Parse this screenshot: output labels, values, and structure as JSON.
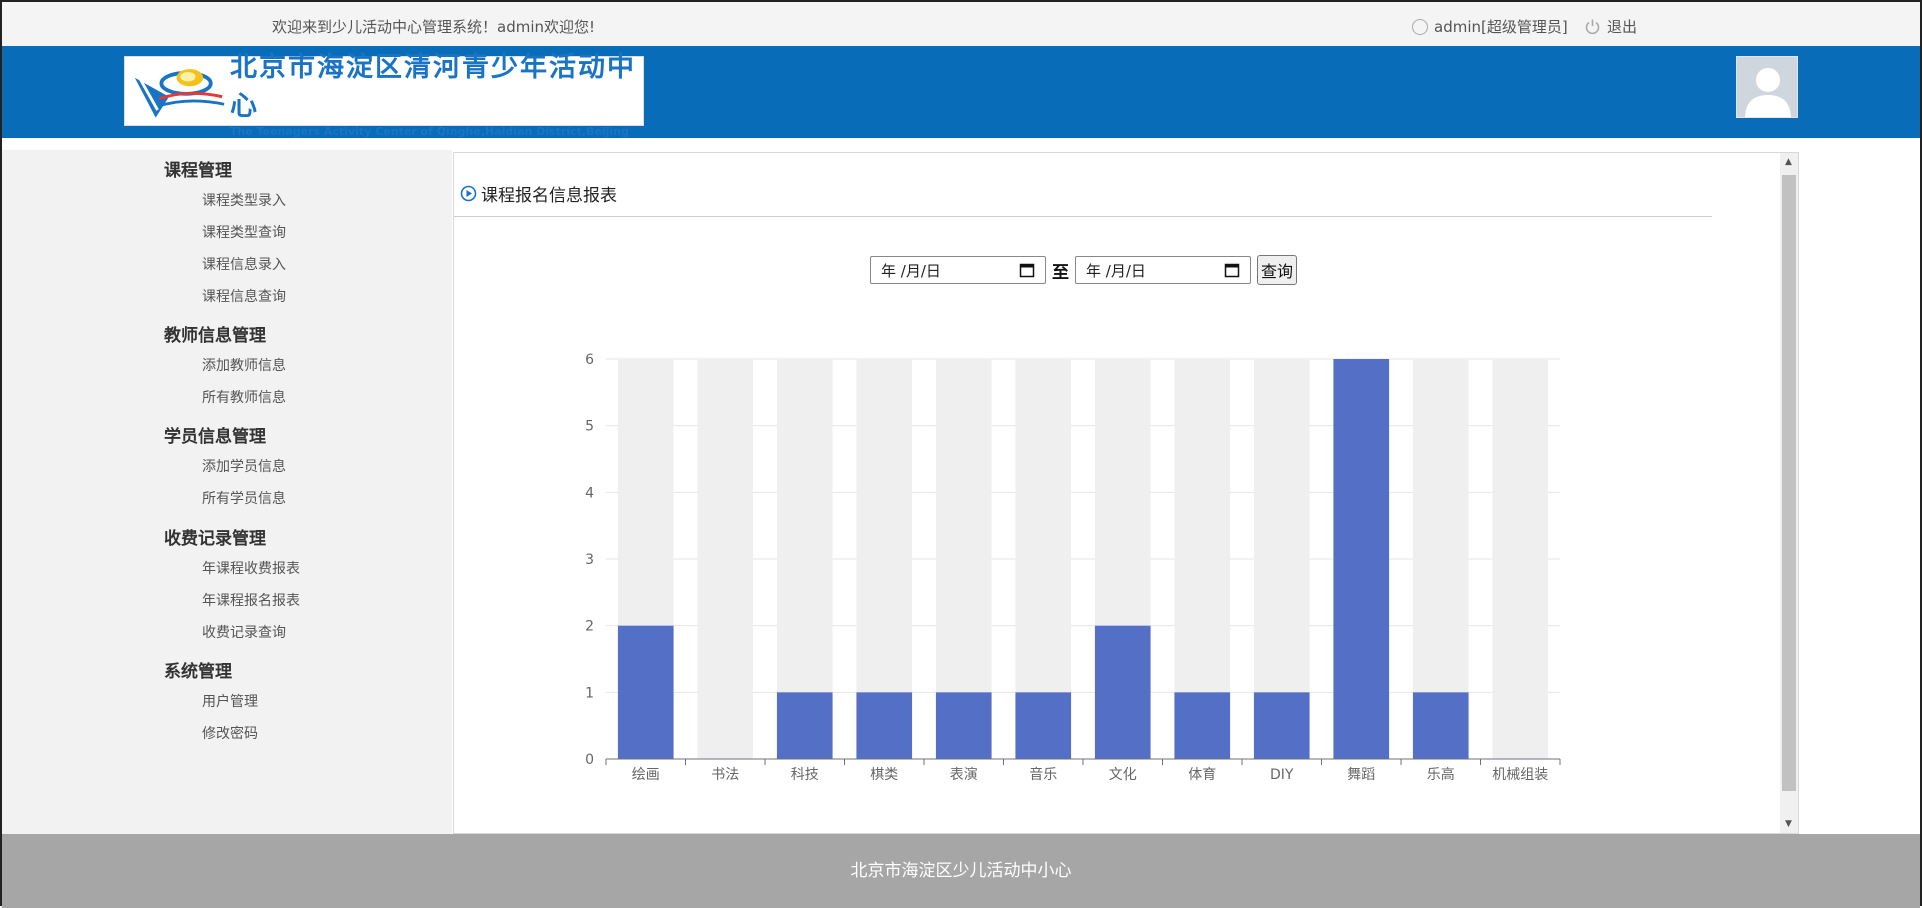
{
  "topbar": {
    "welcome": "欢迎来到少儿活动中心管理系统！admin欢迎您!",
    "user": "admin[超级管理员]",
    "logout": "退出"
  },
  "header": {
    "logo_cn": "北京市海淀区清河青少年活动中心",
    "logo_en": "The Teenagers Activity Center of Qinghe,Haidian District,Beijing",
    "bg_color": "#086cb8"
  },
  "sidebar": {
    "groups": [
      {
        "title": "课程管理",
        "items": [
          "课程类型录入",
          "课程类型查询",
          "课程信息录入",
          "课程信息查询"
        ]
      },
      {
        "title": "教师信息管理",
        "items": [
          "添加教师信息",
          "所有教师信息"
        ]
      },
      {
        "title": "学员信息管理",
        "items": [
          "添加学员信息",
          "所有学员信息"
        ]
      },
      {
        "title": "收费记录管理",
        "items": [
          "年课程收费报表",
          "年课程报名报表",
          "收费记录查询"
        ]
      },
      {
        "title": "系统管理",
        "items": [
          "用户管理",
          "修改密码"
        ]
      }
    ]
  },
  "panel": {
    "title": "课程报名信息报表",
    "date_from": "年 /月/日",
    "date_to": "年 /月/日",
    "to_label": "至",
    "query_button": "查询"
  },
  "chart_data": {
    "type": "bar",
    "categories": [
      "绘画",
      "书法",
      "科技",
      "棋类",
      "表演",
      "音乐",
      "文化",
      "体育",
      "DIY",
      "舞蹈",
      "乐高",
      "机械组装"
    ],
    "values": [
      2,
      0,
      1,
      1,
      1,
      1,
      2,
      1,
      1,
      6,
      1,
      0
    ],
    "ylim": [
      0,
      6
    ],
    "yticks": [
      0,
      1,
      2,
      3,
      4,
      5,
      6
    ],
    "bar_color": "#5470c6",
    "background_bar_color": "#efefef",
    "grid": true
  },
  "footer": {
    "text": "北京市海淀区少儿活动中小心"
  }
}
